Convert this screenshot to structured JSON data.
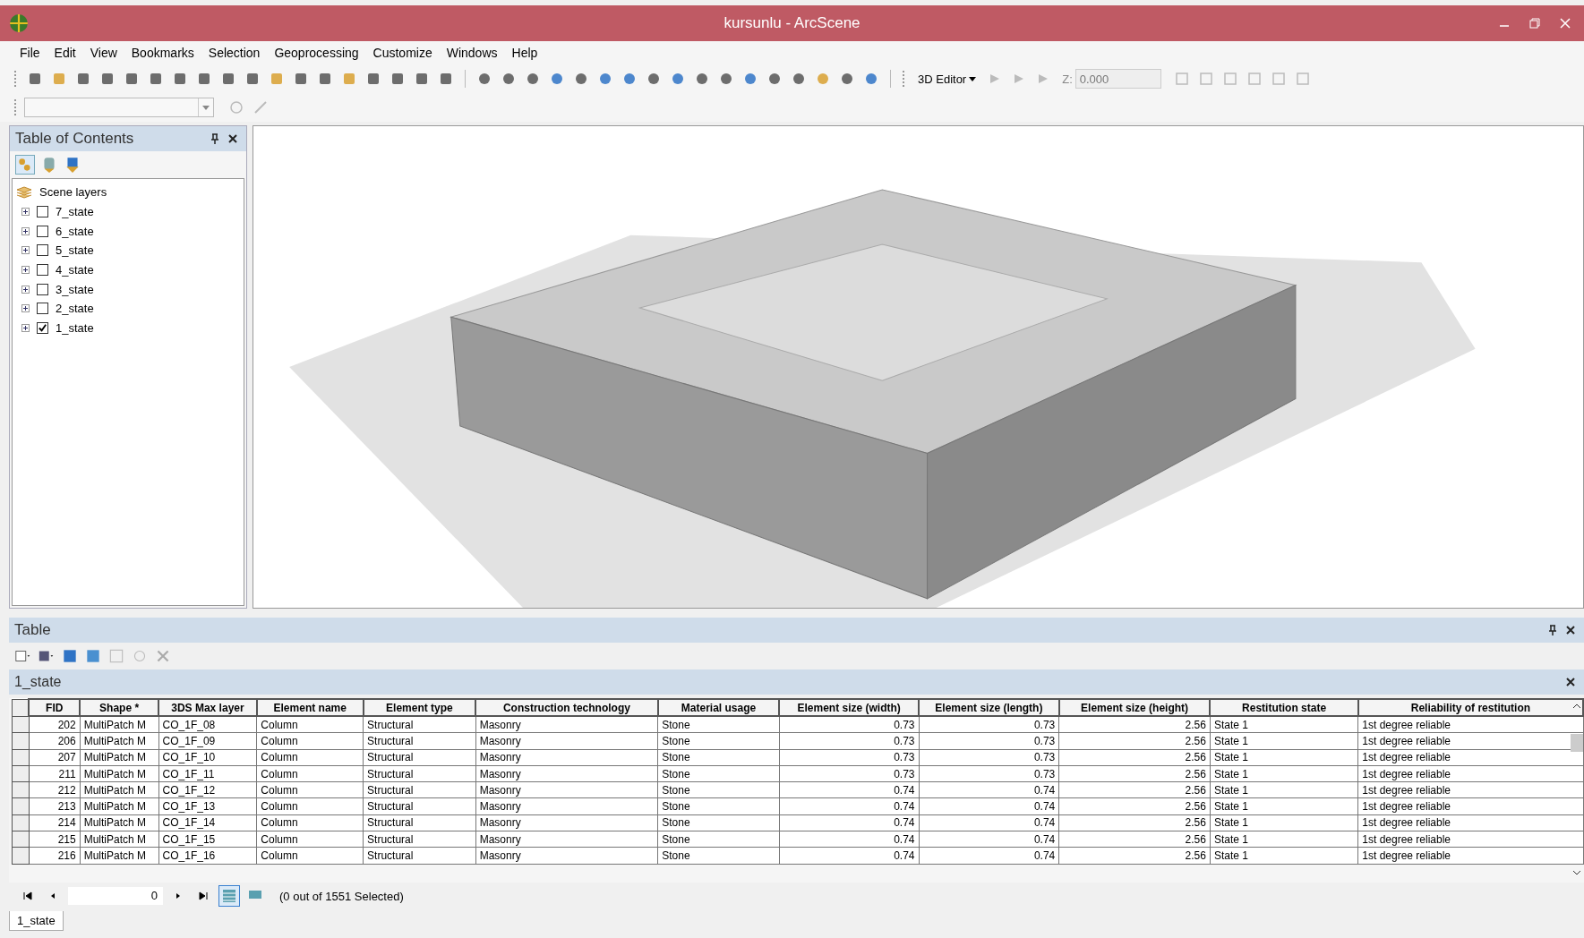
{
  "window": {
    "title": "kursunlu - ArcScene"
  },
  "menu": [
    "File",
    "Edit",
    "View",
    "Bookmarks",
    "Selection",
    "Geoprocessing",
    "Customize",
    "Windows",
    "Help"
  ],
  "toolbar": {
    "editor_menu": "3D Editor",
    "z_label": "Z:",
    "z_value": "0.000"
  },
  "toc": {
    "title": "Table of Contents",
    "root": "Scene layers",
    "layers": [
      {
        "name": "7_state",
        "checked": false,
        "expanded": false
      },
      {
        "name": "6_state",
        "checked": false,
        "expanded": false
      },
      {
        "name": "5_state",
        "checked": false,
        "expanded": false
      },
      {
        "name": "4_state",
        "checked": false,
        "expanded": false
      },
      {
        "name": "3_state",
        "checked": false,
        "expanded": false
      },
      {
        "name": "2_state",
        "checked": false,
        "expanded": false
      },
      {
        "name": "1_state",
        "checked": true,
        "expanded": false
      }
    ]
  },
  "table": {
    "title": "Table",
    "layer": "1_state",
    "columns": [
      {
        "label": "FID",
        "kind": "number"
      },
      {
        "label": "Shape *",
        "kind": "text"
      },
      {
        "label": "3DS Max layer",
        "kind": "text"
      },
      {
        "label": "Element name",
        "kind": "text"
      },
      {
        "label": "Element type",
        "kind": "text"
      },
      {
        "label": "Construction technology",
        "kind": "text"
      },
      {
        "label": "Material usage",
        "kind": "text"
      },
      {
        "label": "Element size (width)",
        "kind": "number"
      },
      {
        "label": "Element size (length)",
        "kind": "number"
      },
      {
        "label": "Element size (height)",
        "kind": "number"
      },
      {
        "label": "Restitution state",
        "kind": "text"
      },
      {
        "label": "Reliability of  restitution",
        "kind": "text"
      }
    ],
    "rows": [
      [
        "202",
        "MultiPatch M",
        "CO_1F_08",
        "Column",
        "Structural",
        "Masonry",
        "Stone",
        "0.73",
        "0.73",
        "2.56",
        "State 1",
        "1st degree reliable"
      ],
      [
        "206",
        "MultiPatch M",
        "CO_1F_09",
        "Column",
        "Structural",
        "Masonry",
        "Stone",
        "0.73",
        "0.73",
        "2.56",
        "State 1",
        "1st degree reliable"
      ],
      [
        "207",
        "MultiPatch M",
        "CO_1F_10",
        "Column",
        "Structural",
        "Masonry",
        "Stone",
        "0.73",
        "0.73",
        "2.56",
        "State 1",
        "1st degree reliable"
      ],
      [
        "211",
        "MultiPatch M",
        "CO_1F_11",
        "Column",
        "Structural",
        "Masonry",
        "Stone",
        "0.73",
        "0.73",
        "2.56",
        "State 1",
        "1st degree reliable"
      ],
      [
        "212",
        "MultiPatch M",
        "CO_1F_12",
        "Column",
        "Structural",
        "Masonry",
        "Stone",
        "0.74",
        "0.74",
        "2.56",
        "State 1",
        "1st degree reliable"
      ],
      [
        "213",
        "MultiPatch M",
        "CO_1F_13",
        "Column",
        "Structural",
        "Masonry",
        "Stone",
        "0.74",
        "0.74",
        "2.56",
        "State 1",
        "1st degree reliable"
      ],
      [
        "214",
        "MultiPatch M",
        "CO_1F_14",
        "Column",
        "Structural",
        "Masonry",
        "Stone",
        "0.74",
        "0.74",
        "2.56",
        "State 1",
        "1st degree reliable"
      ],
      [
        "215",
        "MultiPatch M",
        "CO_1F_15",
        "Column",
        "Structural",
        "Masonry",
        "Stone",
        "0.74",
        "0.74",
        "2.56",
        "State 1",
        "1st degree reliable"
      ],
      [
        "216",
        "MultiPatch M",
        "CO_1F_16",
        "Column",
        "Structural",
        "Masonry",
        "Stone",
        "0.74",
        "0.74",
        "2.56",
        "State 1",
        "1st degree reliable"
      ]
    ],
    "record": "0",
    "selection_status": "(0 out of 1551 Selected)"
  },
  "bottom_tabs": [
    {
      "label": "1_state",
      "selected": true
    }
  ]
}
